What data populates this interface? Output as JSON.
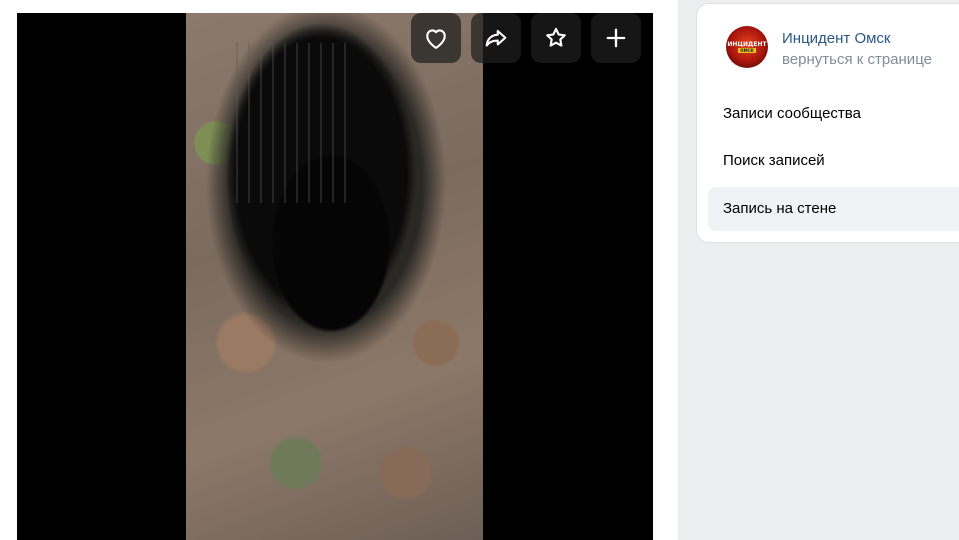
{
  "sidebar": {
    "group_name": "Инцидент Омск",
    "back_link": "вернуться к странице",
    "avatar_text": "ИНЦИДЕНТ",
    "avatar_stripe": "ОМСК",
    "menu": [
      {
        "label": "Записи сообщества",
        "active": false
      },
      {
        "label": "Поиск записей",
        "active": false
      },
      {
        "label": "Запись на стене",
        "active": true
      }
    ]
  },
  "actions": [
    {
      "name": "like",
      "icon": "heart-icon"
    },
    {
      "name": "share",
      "icon": "share-arrow-icon"
    },
    {
      "name": "bookmark",
      "icon": "star-icon"
    },
    {
      "name": "add",
      "icon": "plus-icon"
    }
  ],
  "colors": {
    "link": "#2a5885",
    "muted": "#818c99",
    "page_bg": "#edeef0",
    "active_item_bg": "#f0f2f5"
  }
}
